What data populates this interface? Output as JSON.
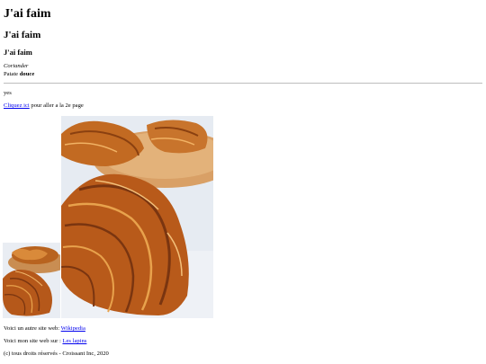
{
  "headings": {
    "h1": "J'ai faim",
    "h2": "J'ai faim",
    "h3": "J'ai faim"
  },
  "address": {
    "line1_italic": "Coriander",
    "line2_plain": "Patate ",
    "line2_bold": "douce"
  },
  "status_text": "yes",
  "page_link": {
    "link_text": "Cliquez ici",
    "after_text": " pour aller a la 2e page"
  },
  "images": {
    "small_alt": "croissant",
    "large_alt": "croissant"
  },
  "other_site": {
    "prefix": "Voici un autre site web: ",
    "link_text": "Wikipedia"
  },
  "my_site": {
    "prefix": "Voici mon site web sur : ",
    "link_text": "Les lapins"
  },
  "footer": "(c) tous droits réservés - Croissant Inc, 2020",
  "colors": {
    "link": "#0000ee",
    "croissant_dark": "#7a3a10",
    "croissant_mid": "#c0651f",
    "croissant_light": "#e8a24c",
    "plate": "#d9a066",
    "backdrop": "#e9edf3"
  }
}
